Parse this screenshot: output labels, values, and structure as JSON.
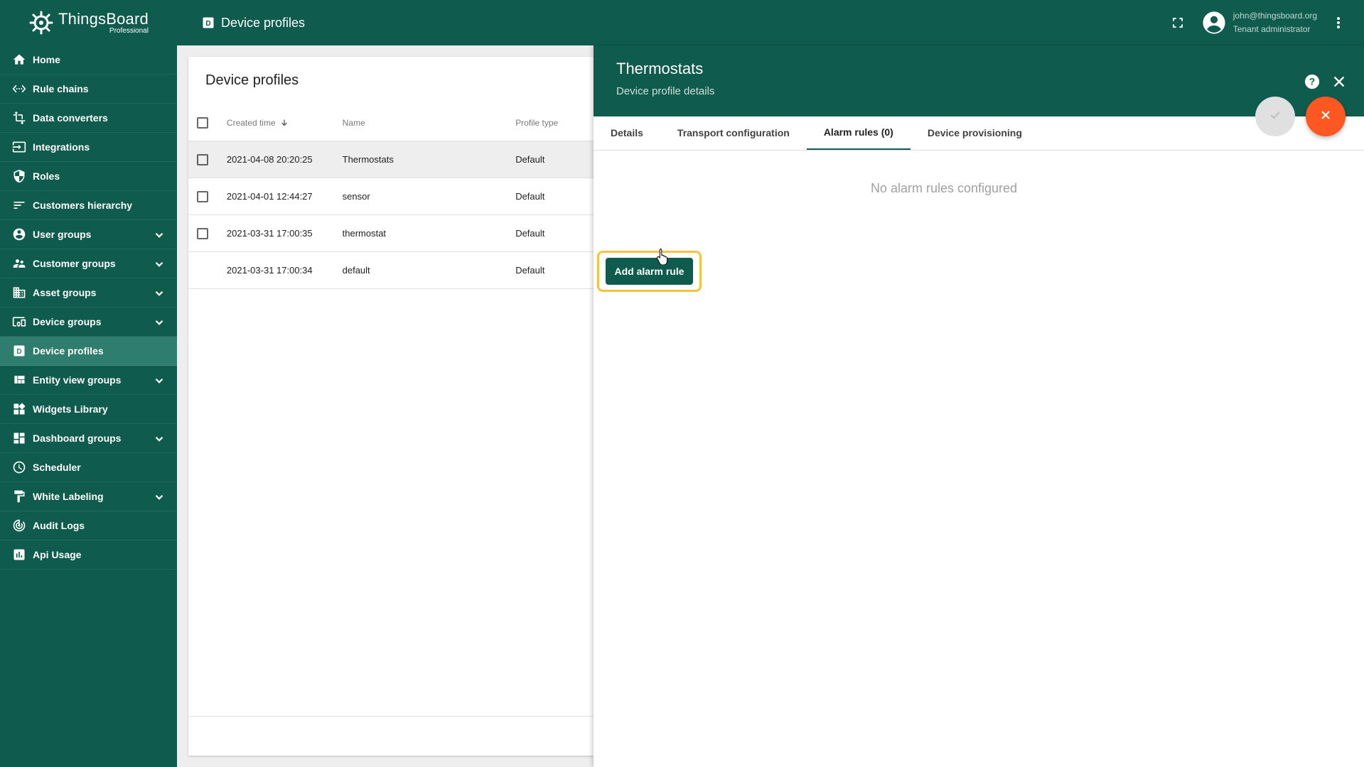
{
  "app": {
    "logo_name": "ThingsBoard",
    "logo_sub": "Professional"
  },
  "sidebar": {
    "items": [
      {
        "label": "Home",
        "icon": "home-icon",
        "expandable": false,
        "active": false
      },
      {
        "label": "Rule chains",
        "icon": "settings-ethernet-icon",
        "expandable": false,
        "active": false
      },
      {
        "label": "Data converters",
        "icon": "transform-icon",
        "expandable": false,
        "active": false
      },
      {
        "label": "Integrations",
        "icon": "input-icon",
        "expandable": false,
        "active": false
      },
      {
        "label": "Roles",
        "icon": "security-icon",
        "expandable": false,
        "active": false
      },
      {
        "label": "Customers hierarchy",
        "icon": "sort-icon",
        "expandable": false,
        "active": false
      },
      {
        "label": "User groups",
        "icon": "account-circle-icon",
        "expandable": true,
        "active": false
      },
      {
        "label": "Customer groups",
        "icon": "supervisor-account-icon",
        "expandable": true,
        "active": false
      },
      {
        "label": "Asset groups",
        "icon": "domain-icon",
        "expandable": true,
        "active": false
      },
      {
        "label": "Device groups",
        "icon": "devices-other-icon",
        "expandable": true,
        "active": false
      },
      {
        "label": "Device profiles",
        "icon": "device-profile-icon",
        "expandable": false,
        "active": true
      },
      {
        "label": "Entity view groups",
        "icon": "view-quilt-icon",
        "expandable": true,
        "active": false
      },
      {
        "label": "Widgets Library",
        "icon": "widgets-icon",
        "expandable": false,
        "active": false
      },
      {
        "label": "Dashboard groups",
        "icon": "dashboard-icon",
        "expandable": true,
        "active": false
      },
      {
        "label": "Scheduler",
        "icon": "schedule-icon",
        "expandable": false,
        "active": false
      },
      {
        "label": "White Labeling",
        "icon": "format-paint-icon",
        "expandable": true,
        "active": false
      },
      {
        "label": "Audit Logs",
        "icon": "track-changes-icon",
        "expandable": false,
        "active": false
      },
      {
        "label": "Api Usage",
        "icon": "insert-chart-icon",
        "expandable": false,
        "active": false
      }
    ]
  },
  "topbar": {
    "title": "Device profiles",
    "user_email": "john@thingsboard.org",
    "user_role": "Tenant administrator"
  },
  "list": {
    "title": "Device profiles",
    "columns": {
      "created": "Created time",
      "name": "Name",
      "type": "Profile type"
    },
    "rows": [
      {
        "created": "2021-04-08 20:20:25",
        "name": "Thermostats",
        "type": "Default",
        "selected": true,
        "checkbox": true
      },
      {
        "created": "2021-04-01 12:44:27",
        "name": "sensor",
        "type": "Default",
        "selected": false,
        "checkbox": true
      },
      {
        "created": "2021-03-31 17:00:35",
        "name": "thermostat",
        "type": "Default",
        "selected": false,
        "checkbox": true
      },
      {
        "created": "2021-03-31 17:00:34",
        "name": "default",
        "type": "Default",
        "selected": false,
        "checkbox": false
      }
    ]
  },
  "details": {
    "title": "Thermostats",
    "subtitle": "Device profile details",
    "tabs": [
      {
        "label": "Details",
        "active": false
      },
      {
        "label": "Transport configuration",
        "active": false
      },
      {
        "label": "Alarm rules (0)",
        "active": true
      },
      {
        "label": "Device provisioning",
        "active": false
      }
    ],
    "empty_message": "No alarm rules configured",
    "add_button": "Add alarm rule"
  },
  "colors": {
    "primary": "#0f5b4e",
    "active_item": "#2e7d6e",
    "accent": "#ff5722",
    "highlight": "#f5c242"
  }
}
